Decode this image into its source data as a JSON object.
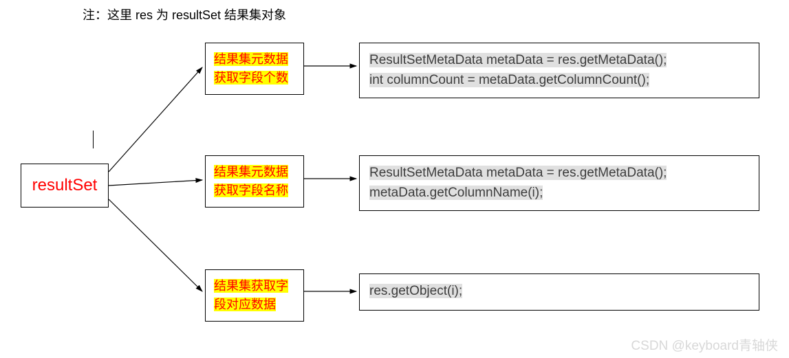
{
  "note": "注：这里 res 为 resultSet 结果集对象",
  "root": "resultSet",
  "branches": [
    {
      "label_line1": "结果集元数据",
      "label_line2": "获取字段个数",
      "code_line1": "ResultSetMetaData metaData = res.getMetaData();",
      "code_line2": "int columnCount = metaData.getColumnCount();"
    },
    {
      "label_line1": "结果集元数据",
      "label_line2": "获取字段名称",
      "code_line1": "ResultSetMetaData metaData = res.getMetaData();",
      "code_line2": "metaData.getColumnName(i);"
    },
    {
      "label_line1": "结果集获取字",
      "label_line2": "段对应数据",
      "code_line1": "res.getObject(i);",
      "code_line2": ""
    }
  ],
  "watermark": "CSDN @keyboard青轴侠"
}
